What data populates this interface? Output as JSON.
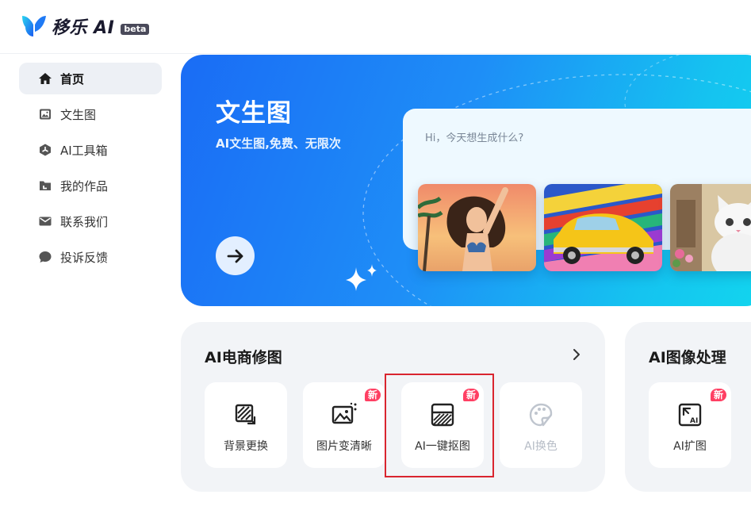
{
  "app": {
    "name": "移乐 AI",
    "badge": "beta"
  },
  "sidebar": {
    "items": [
      {
        "label": "首页",
        "icon": "home-icon",
        "active": true
      },
      {
        "label": "文生图",
        "icon": "image-icon",
        "active": false
      },
      {
        "label": "AI工具箱",
        "icon": "toolbox-icon",
        "active": false
      },
      {
        "label": "我的作品",
        "icon": "folder-icon",
        "active": false
      },
      {
        "label": "联系我们",
        "icon": "mail-icon",
        "active": false
      },
      {
        "label": "投诉反馈",
        "icon": "chat-bubble-icon",
        "active": false
      }
    ]
  },
  "hero": {
    "title": "文生图",
    "subtitle": "AI文生图,免费、无限次",
    "prompt_placeholder": "Hi，今天想生成什么?",
    "arrow_icon": "arrow-right-icon",
    "thumbnails": [
      "woman-on-beach-thumbnail",
      "yellow-car-thumbnail",
      "white-cat-thumbnail"
    ]
  },
  "ecommerce": {
    "title": "AI电商修图",
    "tools": [
      {
        "label": "背景更换",
        "icon": "background-replace-icon",
        "new": false,
        "disabled": false
      },
      {
        "label": "图片变清晰",
        "icon": "image-enhance-icon",
        "new": true,
        "disabled": false
      },
      {
        "label": "AI一键抠图",
        "icon": "cutout-icon",
        "new": true,
        "disabled": false
      },
      {
        "label": "AI换色",
        "icon": "palette-icon",
        "new": false,
        "disabled": true
      }
    ]
  },
  "image_processing": {
    "title": "AI图像处理",
    "tools": [
      {
        "label": "AI扩图",
        "icon": "expand-image-icon",
        "new": true,
        "disabled": false
      }
    ]
  },
  "new_badge_label": "新",
  "colors": {
    "accent": "#1a6cf5",
    "badge": "#ff3f63",
    "highlight": "#d9252f"
  }
}
